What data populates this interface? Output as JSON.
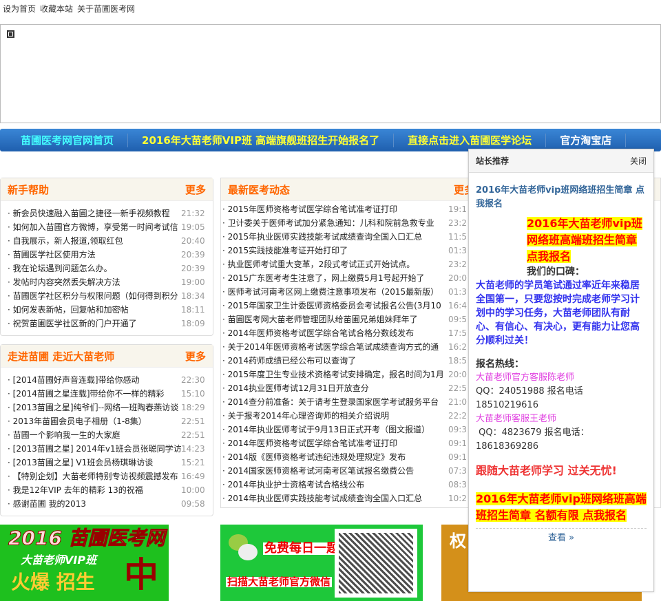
{
  "toplinks": [
    "设为首页",
    "收藏本站",
    "关于苗圃医考网"
  ],
  "nav": [
    {
      "label": "苗圃医考网官网首页",
      "color": "#4ff"
    },
    {
      "label": "2016年大苗老师VIP班  高端旗舰班招生开始报名了",
      "color": "#ff3"
    },
    {
      "label": "直接点击进入苗圃医学论坛",
      "color": "#ff3"
    },
    {
      "label": "官方淘宝店",
      "color": "#fff"
    }
  ],
  "help": {
    "title": "新手帮助",
    "more": "更多",
    "items": [
      {
        "t": "新会员快速融入苗圃之捷径一新手视频教程",
        "tm": "21:32"
      },
      {
        "t": "如何加入苗圃官方微博，享受第一时间考试信",
        "tm": "19:05"
      },
      {
        "t": "自我展示，新人报道,领取红包",
        "tm": "20:40"
      },
      {
        "t": "苗圃医学社区使用方法",
        "tm": "20:39"
      },
      {
        "t": "我在论坛遇到问题怎么办。",
        "tm": "20:39"
      },
      {
        "t": "发帖时内容突然丢失解决方法",
        "tm": "19:00"
      },
      {
        "t": "苗圃医学社区积分与权限问题（如何得到积分",
        "tm": "18:34"
      },
      {
        "t": "如何发表新帖，回复帖和加密帖",
        "tm": "18:11"
      },
      {
        "t": "祝贺苗圃医学社区新的门户开通了",
        "tm": "18:09"
      }
    ]
  },
  "about": {
    "title": "走进苗圃  走近大苗老师",
    "more": "更多",
    "items": [
      {
        "t": "[2014苗圃好声音连载]带给你感动",
        "tm": "22:30"
      },
      {
        "t": "[2014苗圃之星连载]带给你不一样的精彩",
        "tm": "15:10"
      },
      {
        "t": "[2013苗圃之星]纯爷们--网络一班陶春燕访谈",
        "tm": "18:29"
      },
      {
        "t": "2013年苗圃会员电子相册（1-8集）",
        "tm": "22:51"
      },
      {
        "t": "苗圃一个影响我一生的大家庭",
        "tm": "22:51"
      },
      {
        "t": "[2013苗圃之星] 2014年v1班会员张聪同学访",
        "tm": "14:23"
      },
      {
        "t": "[2013苗圃之星] V1班会员杨琪琳访谈",
        "tm": "15:21"
      },
      {
        "t": "【特别企划】大苗老师特别专访视频震撼发布",
        "tm": "16:49"
      },
      {
        "t": "我是12年VIP 去年的精彩  13的祝福",
        "tm": "10:00"
      },
      {
        "t": "感谢苗圃  我的2013",
        "tm": "09:58"
      }
    ]
  },
  "news": {
    "title": "最新医考动态",
    "more": "更多",
    "items": [
      {
        "t": "2015年医师资格考试医学综合笔试准考证打印",
        "tm": "19:1"
      },
      {
        "t": "卫计委关于医师考试加分紧急通知：儿科和院前急救专业",
        "tm": "23:2"
      },
      {
        "t": "2015年执业医师实践技能考试成绩查询全国入口汇总",
        "tm": "11:5"
      },
      {
        "t": "2015实践技能准考证开始打印了",
        "tm": "01:3"
      },
      {
        "t": "执业医师考试重大变革，2段式考试正式开始试点。",
        "tm": "23:2"
      },
      {
        "t": "2015广东医考考生注意了，网上缴费5月1号起开始了",
        "tm": "20:0"
      },
      {
        "t": "医师考试河南考区网上缴费注意事项发布（2015最新版）",
        "tm": "01:3"
      },
      {
        "t": "2015年国家卫生计委医师资格委员会考试报名公告(3月10",
        "tm": "16:4"
      },
      {
        "t": "苗圃医考网大苗老师管理团队给苗圃兄弟姐妹拜年了",
        "tm": "09:5"
      },
      {
        "t": "2014年医师资格考试医学综合笔试合格分数线发布",
        "tm": "17:5"
      },
      {
        "t": "关于2014年医师资格考试医学综合笔试成绩查询方式的通",
        "tm": "16:2"
      },
      {
        "t": "2014药师成绩已经公布可以查询了",
        "tm": "18:5"
      },
      {
        "t": "2015年度卫生专业技术资格考试安排确定，报名时间为1月",
        "tm": "20:0"
      },
      {
        "t": "2014执业医师考试12月31日开放查分",
        "tm": "22:5"
      },
      {
        "t": "2014查分前准备：关于请考生登录国家医学考试服务平台",
        "tm": "21:0"
      },
      {
        "t": "关于报考2014年心理咨询师的相关介绍说明",
        "tm": "22:2"
      },
      {
        "t": "2014年执业医师考试于9月13日正式开考（图文报道）",
        "tm": "09:3"
      },
      {
        "t": "2014年医师资格考试医学综合笔试准考证打印",
        "tm": "09:1"
      },
      {
        "t": "2014版《医师资格考试违纪违规处理规定》发布",
        "tm": "09:1"
      },
      {
        "t": "2014国家医师资格考试河南考区笔试报名缴费公告",
        "tm": "07:3"
      },
      {
        "t": "2014年执业护士资格考试合格线公布",
        "tm": "08:3"
      },
      {
        "t": "2014年执业医师实践技能考试成绩查询全国入口汇总",
        "tm": "10:2"
      }
    ]
  },
  "popup": {
    "title": "站长推荐",
    "close": "关闭",
    "link": "2016年大苗老师vip班网络班招生简章  点我报名",
    "headline": "2016年大苗老师vip班网络班高端班招生简章  点我报名",
    "slogan_label": "我们的口碑：",
    "slogan": "大苗老师的学员笔试通过率近年来稳居全国第一，只要您按时完成老师学习计划中的学习任务，大苗老师团队有耐心、有信心、有决心，更有能力让您高分顺利过关！",
    "hotline": "报名热线：",
    "contact1": "大苗老师官方客服陈老师",
    "qq1": "QQ：24051988 报名电话 18510219616",
    "contact2": "大苗老师客服王老师",
    "qq2": " QQ：4823679 报名电话：18618369286",
    "motto": "跟随大苗老师学习  过关无忧!",
    "bottom": "2016年大苗老师vip班网络班高端班招生简章   名额有限  点我报名",
    "view": "查看 »"
  },
  "banners": {
    "b1_top": "2016 苗圃医考网",
    "b1_mid": "大苗老师VIP班",
    "b1_bot": "火爆 招生",
    "b1_zhong": "中",
    "b2_top": "免费每日一题",
    "b2_bot": "扫描大苗老师官方微信",
    "b3": "权"
  }
}
